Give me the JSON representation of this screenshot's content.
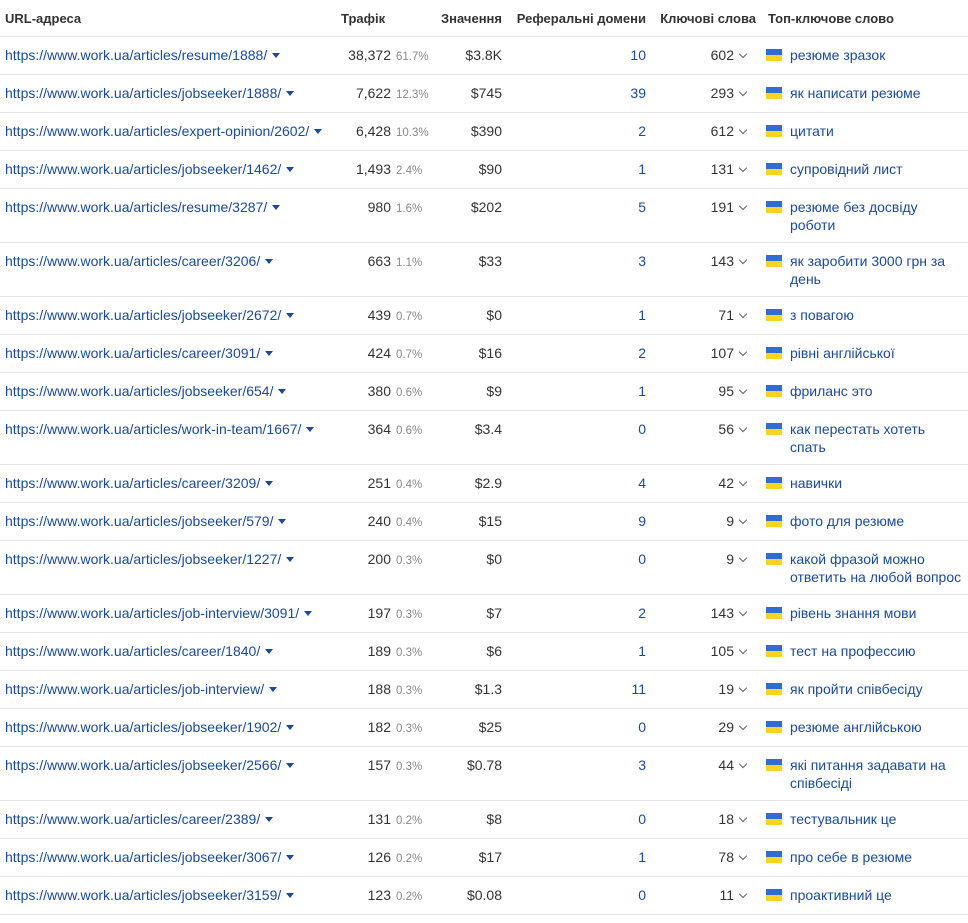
{
  "headers": {
    "url": "URL-адреса",
    "traffic": "Трафік",
    "value": "Значення",
    "ref_domains": "Реферальні домени",
    "keywords": "Ключові слова",
    "top_keyword": "Топ-ключове слово"
  },
  "icons": {
    "url_caret": "caret-down-icon",
    "kw_chevron": "chevron-down-icon",
    "flag": "ukraine-flag-icon"
  },
  "colors": {
    "link": "#1a4a9c",
    "flag_blue": "#2c6fd1",
    "flag_yellow": "#f7d51f"
  },
  "rows": [
    {
      "url": "https://www.work.ua/articles/resume/1888/",
      "traffic": "38,372",
      "pct": "61.7%",
      "value": "$3.8K",
      "ref": "10",
      "kw": "602",
      "top": "резюме зразок"
    },
    {
      "url": "https://www.work.ua/articles/jobseeker/1888/",
      "traffic": "7,622",
      "pct": "12.3%",
      "value": "$745",
      "ref": "39",
      "kw": "293",
      "top": "як написати резюме"
    },
    {
      "url": "https://www.work.ua/articles/expert-opinion/2602/",
      "traffic": "6,428",
      "pct": "10.3%",
      "value": "$390",
      "ref": "2",
      "kw": "612",
      "top": "цитати"
    },
    {
      "url": "https://www.work.ua/articles/jobseeker/1462/",
      "traffic": "1,493",
      "pct": "2.4%",
      "value": "$90",
      "ref": "1",
      "kw": "131",
      "top": "супровідний лист"
    },
    {
      "url": "https://www.work.ua/articles/resume/3287/",
      "traffic": "980",
      "pct": "1.6%",
      "value": "$202",
      "ref": "5",
      "kw": "191",
      "top": "резюме без досвіду роботи"
    },
    {
      "url": "https://www.work.ua/articles/career/3206/",
      "traffic": "663",
      "pct": "1.1%",
      "value": "$33",
      "ref": "3",
      "kw": "143",
      "top": "як заробити 3000 грн за день"
    },
    {
      "url": "https://www.work.ua/articles/jobseeker/2672/",
      "traffic": "439",
      "pct": "0.7%",
      "value": "$0",
      "ref": "1",
      "kw": "71",
      "top": "з повагою"
    },
    {
      "url": "https://www.work.ua/articles/career/3091/",
      "traffic": "424",
      "pct": "0.7%",
      "value": "$16",
      "ref": "2",
      "kw": "107",
      "top": "рівні англійської"
    },
    {
      "url": "https://www.work.ua/articles/jobseeker/654/",
      "traffic": "380",
      "pct": "0.6%",
      "value": "$9",
      "ref": "1",
      "kw": "95",
      "top": "фриланс это"
    },
    {
      "url": "https://www.work.ua/articles/work-in-team/1667/",
      "traffic": "364",
      "pct": "0.6%",
      "value": "$3.4",
      "ref": "0",
      "kw": "56",
      "top": "как перестать хотеть спать"
    },
    {
      "url": "https://www.work.ua/articles/career/3209/",
      "traffic": "251",
      "pct": "0.4%",
      "value": "$2.9",
      "ref": "4",
      "kw": "42",
      "top": "навички"
    },
    {
      "url": "https://www.work.ua/articles/jobseeker/579/",
      "traffic": "240",
      "pct": "0.4%",
      "value": "$15",
      "ref": "9",
      "kw": "9",
      "top": "фото для резюме"
    },
    {
      "url": "https://www.work.ua/articles/jobseeker/1227/",
      "traffic": "200",
      "pct": "0.3%",
      "value": "$0",
      "ref": "0",
      "kw": "9",
      "top": "какой фразой можно ответить на любой вопрос"
    },
    {
      "url": "https://www.work.ua/articles/job-interview/3091/",
      "traffic": "197",
      "pct": "0.3%",
      "value": "$7",
      "ref": "2",
      "kw": "143",
      "top": "рівень знання мови"
    },
    {
      "url": "https://www.work.ua/articles/career/1840/",
      "traffic": "189",
      "pct": "0.3%",
      "value": "$6",
      "ref": "1",
      "kw": "105",
      "top": "тест на профессию"
    },
    {
      "url": "https://www.work.ua/articles/job-interview/",
      "traffic": "188",
      "pct": "0.3%",
      "value": "$1.3",
      "ref": "11",
      "kw": "19",
      "top": "як пройти співбесіду"
    },
    {
      "url": "https://www.work.ua/articles/jobseeker/1902/",
      "traffic": "182",
      "pct": "0.3%",
      "value": "$25",
      "ref": "0",
      "kw": "29",
      "top": "резюме англійською"
    },
    {
      "url": "https://www.work.ua/articles/jobseeker/2566/",
      "traffic": "157",
      "pct": "0.3%",
      "value": "$0.78",
      "ref": "3",
      "kw": "44",
      "top": "які питання задавати на співбесіді"
    },
    {
      "url": "https://www.work.ua/articles/career/2389/",
      "traffic": "131",
      "pct": "0.2%",
      "value": "$8",
      "ref": "0",
      "kw": "18",
      "top": "тестувальник це"
    },
    {
      "url": "https://www.work.ua/articles/jobseeker/3067/",
      "traffic": "126",
      "pct": "0.2%",
      "value": "$17",
      "ref": "1",
      "kw": "78",
      "top": "про себе в резюме"
    },
    {
      "url": "https://www.work.ua/articles/jobseeker/3159/",
      "traffic": "123",
      "pct": "0.2%",
      "value": "$0.08",
      "ref": "0",
      "kw": "11",
      "top": "проактивний це"
    }
  ]
}
